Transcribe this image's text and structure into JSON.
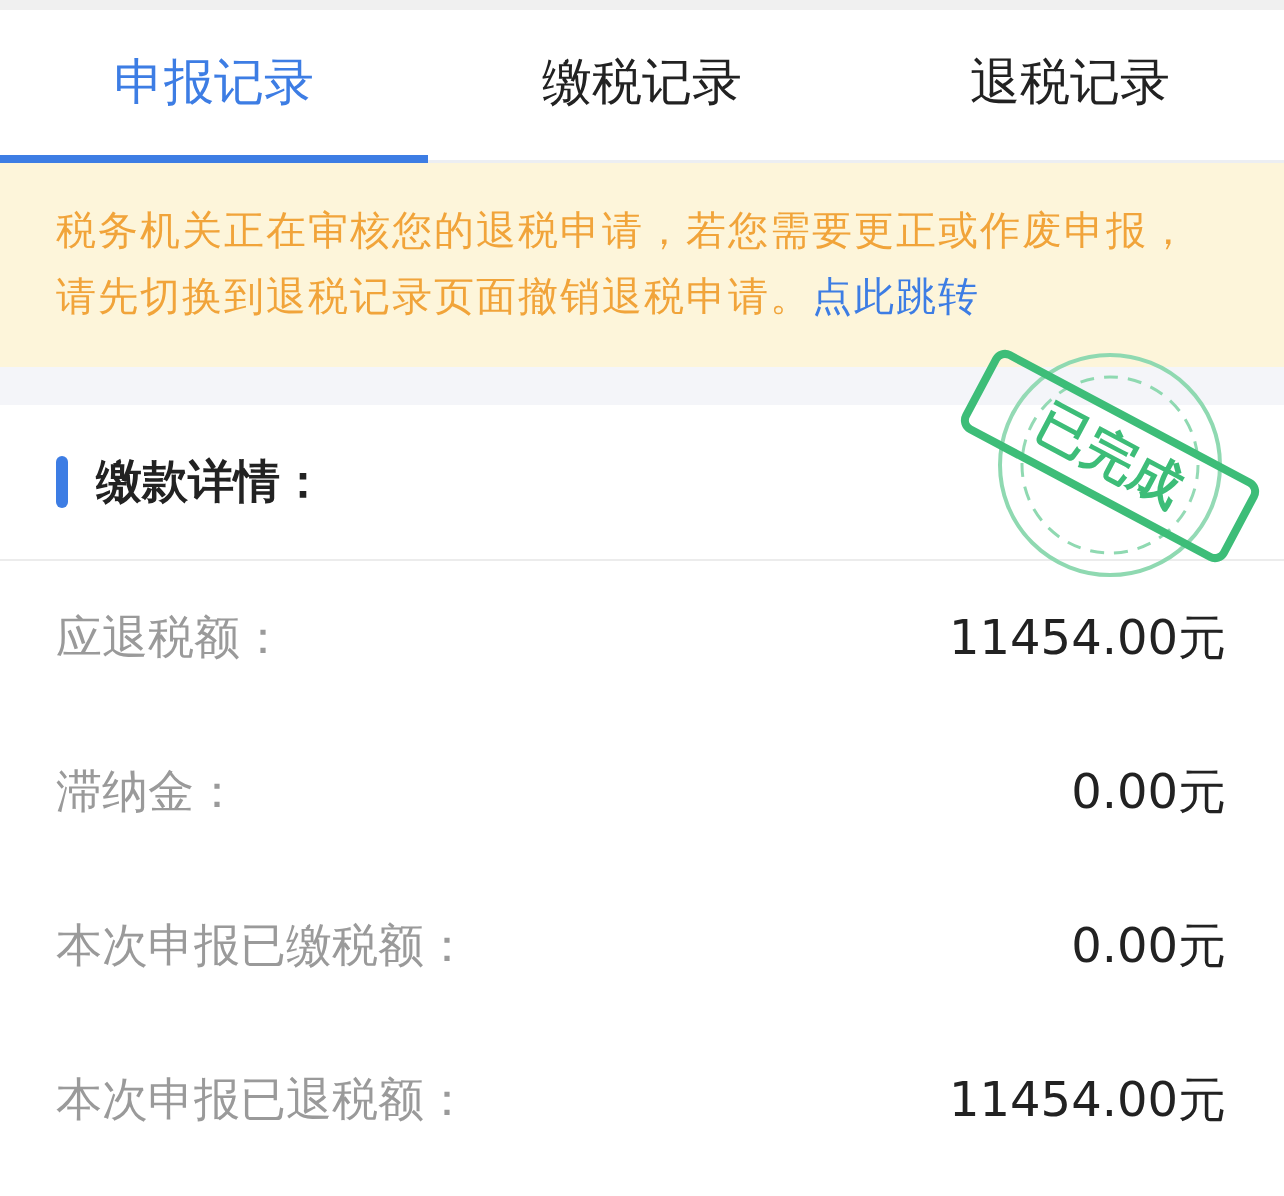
{
  "tabs": [
    {
      "label": "申报记录",
      "selected": true
    },
    {
      "label": "缴税记录",
      "selected": false
    },
    {
      "label": "退税记录",
      "selected": false
    }
  ],
  "notice": {
    "text": "税务机关正在审核您的退税申请，若您需要更正或作废申报，请先切换到退税记录页面撤销退税申请。",
    "link": "点此跳转"
  },
  "stamp": {
    "text": "已完成"
  },
  "section": {
    "title": "缴款详情："
  },
  "rows": [
    {
      "label": "应退税额：",
      "value": "11454.00元"
    },
    {
      "label": "滞纳金：",
      "value": "0.00元"
    },
    {
      "label": "本次申报已缴税额：",
      "value": "0.00元"
    },
    {
      "label": "本次申报已退税额：",
      "value": "11454.00元"
    }
  ]
}
